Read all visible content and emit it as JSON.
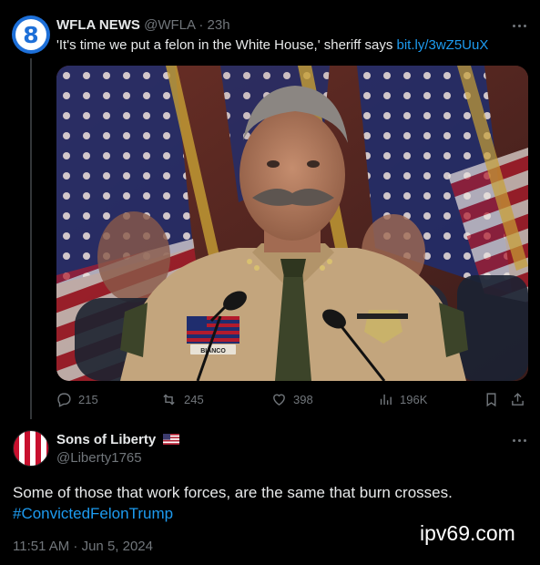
{
  "tweet": {
    "author_name": "WFLA NEWS",
    "author_handle": "@WFLA",
    "separator": " · ",
    "time_ago": "23h",
    "text": "'It's time we put a felon in the White House,' sheriff says ",
    "link": "bit.ly/3wZ5UuX",
    "avatar_glyph": "8",
    "photo": {
      "nameplate": "BIANCO",
      "colors": {
        "flag_red": "#b31b2c",
        "flag_blue": "#1f2d6e",
        "uniform": "#c3a57d",
        "tie": "#3c4429"
      }
    },
    "stats": {
      "replies": "215",
      "retweets": "245",
      "likes": "398",
      "views": "196K"
    },
    "icons": [
      "reply-icon",
      "retweet-icon",
      "like-icon",
      "views-icon",
      "bookmark-icon",
      "share-icon",
      "more-icon"
    ]
  },
  "reply": {
    "author_name": "Sons of Liberty",
    "author_handle": "@Liberty1765",
    "text": "Some of those that work forces, are the same that burn crosses.",
    "hashtag": "#ConvictedFelonTrump",
    "timestamp": "11:51 AM · Jun 5, 2024",
    "badge_icon": "us-flag-icon"
  },
  "watermark": "ipv69.com",
  "colors": {
    "background": "#000000",
    "text": "#e7e9ea",
    "muted": "#71767b",
    "link": "#1d9bf0",
    "wfla_blue": "#1d6fd8"
  }
}
